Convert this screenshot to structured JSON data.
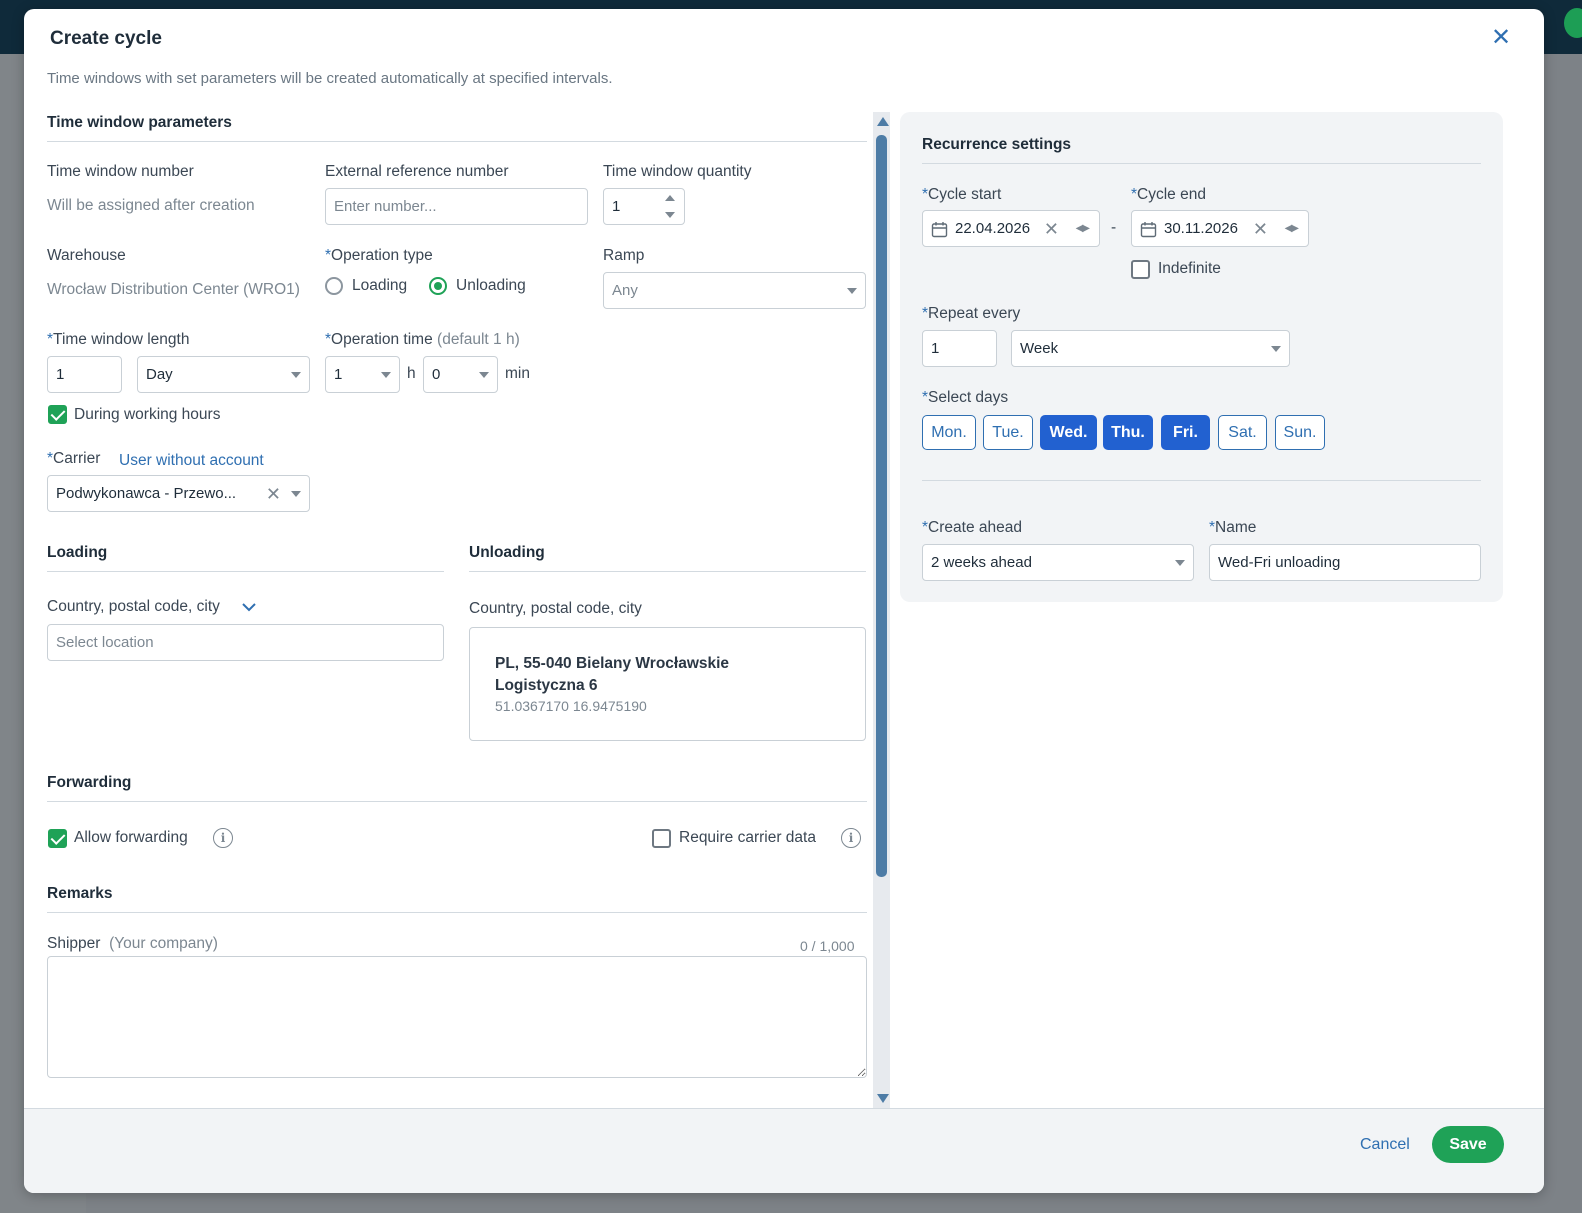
{
  "modal": {
    "title": "Create cycle",
    "subtitle": "Time windows with set parameters will be created automatically at specified intervals.",
    "close_icon": "close-icon"
  },
  "params": {
    "section_title": "Time window parameters",
    "tw_number_label": "Time window number",
    "tw_number_value": "Will be assigned after creation",
    "ext_ref_label": "External reference number",
    "ext_ref_placeholder": "Enter number...",
    "qty_label": "Time window quantity",
    "qty_value": "1",
    "warehouse_label": "Warehouse",
    "warehouse_value": "Wrocław Distribution Center (WRO1)",
    "op_type_label": "Operation type",
    "op_type_options": [
      "Loading",
      "Unloading"
    ],
    "op_type_selected": "Unloading",
    "ramp_label": "Ramp",
    "ramp_value": "Any",
    "tw_length_label": "Time window length",
    "tw_length_value": "1",
    "tw_length_unit": "Day",
    "op_time_label": "Operation time",
    "op_time_hint": "(default 1 h)",
    "op_time_hours": "1",
    "op_time_h_unit": "h",
    "op_time_minutes": "0",
    "op_time_min_unit": "min",
    "working_hours_label": "During working hours",
    "working_hours_checked": true,
    "carrier_label": "Carrier",
    "carrier_link": "User without account",
    "carrier_value": "Podwykonawca - Przewo..."
  },
  "loading": {
    "title": "Loading",
    "location_label": "Country, postal code, city",
    "location_placeholder": "Select location"
  },
  "unloading": {
    "title": "Unloading",
    "location_label": "Country, postal code, city",
    "address_line1": "PL, 55-040 Bielany Wrocławskie",
    "address_line2": "Logistyczna 6",
    "coords": "51.0367170 16.9475190"
  },
  "forwarding": {
    "title": "Forwarding",
    "allow_label": "Allow forwarding",
    "allow_checked": true,
    "require_label": "Require carrier data",
    "require_checked": false
  },
  "remarks": {
    "title": "Remarks",
    "shipper_label": "Shipper",
    "shipper_hint": "(Your company)",
    "counter": "0 / 1,000"
  },
  "recurrence": {
    "title": "Recurrence settings",
    "start_label": "Cycle start",
    "start_value": "22.04.2026",
    "end_label": "Cycle end",
    "end_value": "30.11.2026",
    "range_sep": "-",
    "indefinite_label": "Indefinite",
    "indefinite_checked": false,
    "repeat_label": "Repeat every",
    "repeat_value": "1",
    "repeat_unit": "Week",
    "days_label": "Select days",
    "days": [
      {
        "label": "Mon.",
        "selected": false
      },
      {
        "label": "Tue.",
        "selected": false
      },
      {
        "label": "Wed.",
        "selected": true
      },
      {
        "label": "Thu.",
        "selected": true
      },
      {
        "label": "Fri.",
        "selected": true
      },
      {
        "label": "Sat.",
        "selected": false
      },
      {
        "label": "Sun.",
        "selected": false
      }
    ],
    "ahead_label": "Create ahead",
    "ahead_value": "2 weeks ahead",
    "name_label": "Name",
    "name_value": "Wed-Fri unloading"
  },
  "footer": {
    "cancel_label": "Cancel",
    "save_label": "Save"
  },
  "colors": {
    "accent": "#2f6fb1",
    "day_selected": "#2261d0",
    "success": "#1fa257"
  }
}
